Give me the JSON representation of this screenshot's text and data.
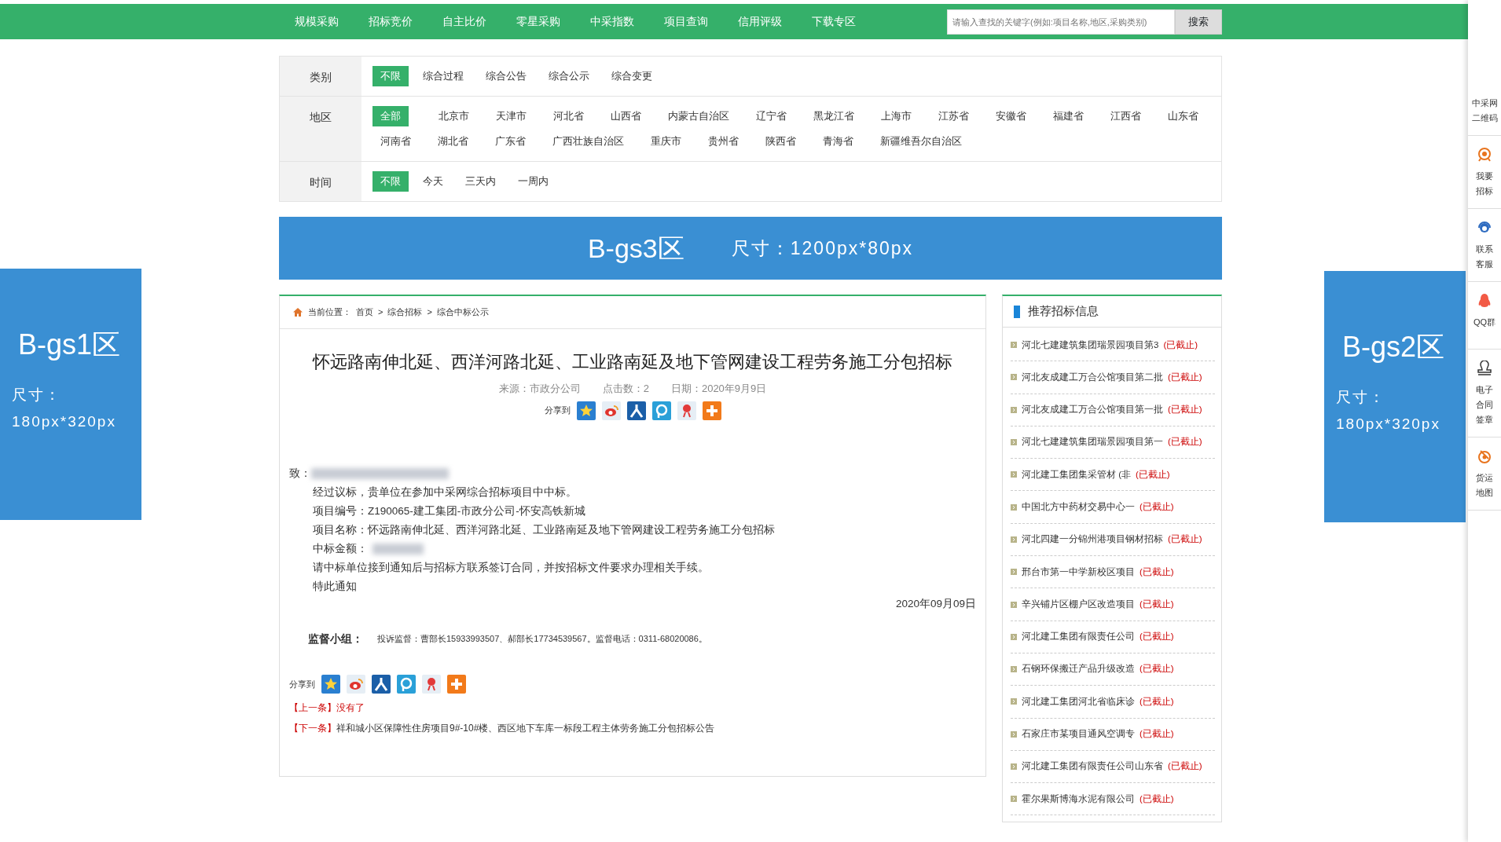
{
  "nav": {
    "items": [
      "规模采购",
      "招标竞价",
      "自主比价",
      "零星采购",
      "中采指数",
      "项目查询",
      "信用评级",
      "下载专区"
    ],
    "search": {
      "placeholder": "请输入查找的关键字(例如:项目名称,地区,采购类别)",
      "button": "搜索"
    }
  },
  "filters": [
    {
      "label": "类别",
      "options": [
        {
          "label": "不限",
          "selected": true
        },
        {
          "label": "综合过程",
          "selected": false
        },
        {
          "label": "综合公告",
          "selected": false
        },
        {
          "label": "综合公示",
          "selected": false
        },
        {
          "label": "综合变更",
          "selected": false
        }
      ]
    },
    {
      "label": "地区",
      "options": [
        {
          "label": "全部",
          "selected": true
        },
        {
          "label": "北京市",
          "selected": false
        },
        {
          "label": "天津市",
          "selected": false
        },
        {
          "label": "河北省",
          "selected": false
        },
        {
          "label": "山西省",
          "selected": false
        },
        {
          "label": "内蒙古自治区",
          "selected": false
        },
        {
          "label": "辽宁省",
          "selected": false
        },
        {
          "label": "黑龙江省",
          "selected": false
        },
        {
          "label": "上海市",
          "selected": false
        },
        {
          "label": "江苏省",
          "selected": false
        },
        {
          "label": "安徽省",
          "selected": false
        },
        {
          "label": "福建省",
          "selected": false
        },
        {
          "label": "江西省",
          "selected": false
        },
        {
          "label": "山东省",
          "selected": false
        },
        {
          "label": "河南省",
          "selected": false
        },
        {
          "label": "湖北省",
          "selected": false
        },
        {
          "label": "广东省",
          "selected": false
        },
        {
          "label": "广西壮族自治区",
          "selected": false
        },
        {
          "label": "重庆市",
          "selected": false
        },
        {
          "label": "贵州省",
          "selected": false
        },
        {
          "label": "陕西省",
          "selected": false
        },
        {
          "label": "青海省",
          "selected": false
        },
        {
          "label": "新疆维吾尔自治区",
          "selected": false
        }
      ]
    },
    {
      "label": "时间",
      "options": [
        {
          "label": "不限",
          "selected": true
        },
        {
          "label": "今天",
          "selected": false
        },
        {
          "label": "三天内",
          "selected": false
        },
        {
          "label": "一周内",
          "selected": false
        }
      ]
    }
  ],
  "banner_top": {
    "name": "B-gs3区",
    "size": "尺寸：1200px*80px"
  },
  "ad_left": {
    "name": "B-gs1区",
    "size_label": "尺寸：",
    "size": "180px*320px"
  },
  "ad_right": {
    "name": "B-gs2区",
    "size_label": "尺寸：",
    "size": "180px*320px"
  },
  "breadcrumb": {
    "label": "当前位置：",
    "crumbs": [
      {
        "label": "首页"
      },
      {
        "sep": ">",
        "label": "综合招标"
      },
      {
        "sep": ">",
        "label": "综合中标公示"
      }
    ]
  },
  "article": {
    "title": "怀远路南伸北延、西洋河路北延、工业路南延及地下管网建设工程劳务施工分包招标",
    "meta": [
      "来源：市政分公司",
      "点击数：2",
      "日期：2020年9月9日"
    ],
    "share_label": "分享到",
    "to": {
      "label": "致：",
      "redacted": true
    },
    "lines": [
      {
        "text": "经过议标，贵单位在参加中采网综合招标项目中中标。",
        "redacted": false
      },
      {
        "text": "项目编号：Z190065-建工集团-市政分公司-怀安高铁新城",
        "redacted": false
      },
      {
        "text": "项目名称：怀远路南伸北延、西洋河路北延、工业路南延及地下管网建设工程劳务施工分包招标",
        "redacted": false
      },
      {
        "text": "中标金额：",
        "redacted": true
      },
      {
        "text": "请中标单位接到通知后与招标方联系签订合同，并按招标文件要求办理相关手续。",
        "redacted": false
      },
      {
        "text": "特此通知",
        "redacted": false
      }
    ],
    "date": "2020年09月09日",
    "supervision": {
      "label": "监督小组：",
      "text": "投诉监督：曹部长15933993507、郝部长17734539567。监督电话：0311-68020086。"
    },
    "share_label_bottom": "分享到",
    "prev": {
      "label": "【上一条】",
      "text": "没有了"
    },
    "next": {
      "label": "【下一条】",
      "text": "祥和城小区保障性住房项目9#-10#楼、西区地下车库一标段工程主体劳务施工分包招标公告"
    }
  },
  "recommend": {
    "title": "推荐招标信息",
    "items": [
      {
        "text": "河北七建建筑集团瑞景园项目第3",
        "status": "(已截止)"
      },
      {
        "text": "河北友成建工万合公馆项目第二批",
        "status": "(已截止)"
      },
      {
        "text": "河北友成建工万合公馆项目第一批",
        "status": "(已截止)"
      },
      {
        "text": "河北七建建筑集团瑞景园项目第一",
        "status": "(已截止)"
      },
      {
        "text": "河北建工集团集采管材 (非",
        "status": "(已截止)"
      },
      {
        "text": "中国北方中药材交易中心一",
        "status": "(已截止)"
      },
      {
        "text": "河北四建一分锦州港项目钢材招标",
        "status": "(已截止)"
      },
      {
        "text": "邢台市第一中学新校区项目",
        "status": "(已截止)"
      },
      {
        "text": "辛兴铺片区棚户区改造项目",
        "status": "(已截止)"
      },
      {
        "text": "河北建工集团有限责任公司",
        "status": "(已截止)"
      },
      {
        "text": "石钢环保搬迁产品升级改造",
        "status": "(已截止)"
      },
      {
        "text": "河北建工集团河北省临床诊",
        "status": "(已截止)"
      },
      {
        "text": "石家庄市某项目通风空调专",
        "status": "(已截止)"
      },
      {
        "text": "河北建工集团有限责任公司山东省",
        "status": "(已截止)"
      },
      {
        "text": "霍尔果斯博海水泥有限公司",
        "status": "(已截止)"
      }
    ]
  },
  "sidebar": [
    {
      "kind": "qr",
      "lines": [
        "中采网",
        "二维码"
      ]
    },
    {
      "kind": "target",
      "lines": [
        "我要",
        "招标"
      ]
    },
    {
      "kind": "headset",
      "lines": [
        "联系",
        "客服"
      ]
    },
    {
      "kind": "penguin",
      "lines": [
        "QQ群"
      ]
    },
    {
      "kind": "stamp",
      "lines": [
        "电子",
        "合同",
        "签章"
      ]
    },
    {
      "kind": "cargo",
      "lines": [
        "货运",
        "地图"
      ]
    }
  ]
}
